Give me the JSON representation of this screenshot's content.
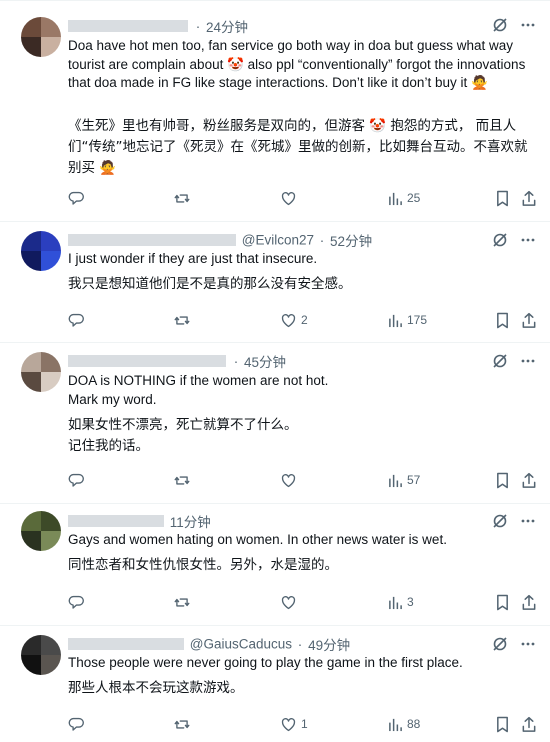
{
  "tweets": [
    {
      "handle": "",
      "time": "24分钟",
      "text": "Doa have hot men too, fan service go both way in doa but guess what way tourist are complain about 🤡 also ppl “conventionally” forgot the innovations that doa made in FG like stage interactions. Don’t like it don’t buy it 🙅",
      "translation": "《生死》里也有帅哥，粉丝服务是双向的，但游客 🤡 抱怨的方式， 而且人们“传统”地忘记了《死灵》在《死城》里做的创新，比如舞台互动。不喜欢就别买 🙅",
      "likes": "",
      "views": "25"
    },
    {
      "handle": "@Evilcon27",
      "time": "52分钟",
      "text": "I just wonder if they are just that insecure.",
      "translation": "我只是想知道他们是不是真的那么没有安全感。",
      "likes": "2",
      "views": "175"
    },
    {
      "handle": "",
      "time": "45分钟",
      "text": "DOA is NOTHING if the women are not hot.\nMark my word.",
      "translation": "如果女性不漂亮，死亡就算不了什么。\n记住我的话。",
      "likes": "",
      "views": "57"
    },
    {
      "handle": "",
      "time": "11分钟",
      "text": "Gays and women hating on women. In other news water is wet.",
      "translation": "同性恋者和女性仇恨女性。另外，水是湿的。",
      "likes": "",
      "views": "3"
    },
    {
      "handle": "@GaiusCaducus",
      "time": "49分钟",
      "text": "Those people were never going to play the game in the first place.",
      "translation": "那些人根本不会玩这款游戏。",
      "likes": "1",
      "views": "88"
    }
  ],
  "icons": {
    "reply": "reply-icon",
    "retweet": "retweet-icon",
    "like": "heart-icon",
    "views": "views-icon",
    "bookmark": "bookmark-icon",
    "share": "share-icon",
    "grok": "grok-icon",
    "more": "more-icon"
  },
  "colors": {
    "text": "#0f1419",
    "secondary": "#536471",
    "border": "#eff3f4"
  }
}
